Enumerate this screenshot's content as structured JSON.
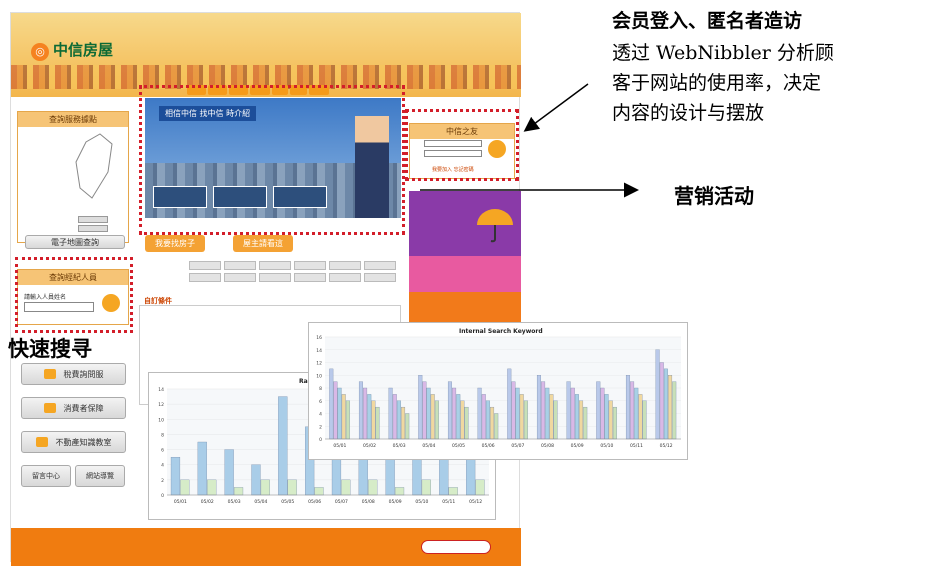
{
  "annotations": {
    "member_title": "会员登入、匿名者造访",
    "member_desc_lines": [
      "透过 WebNibbler 分析顾",
      "客于网站的使用率，决定",
      "内容的设计与摆放"
    ],
    "marketing": "营销活动",
    "quick_search": "快速搜寻"
  },
  "site": {
    "logo_text": "中信房屋",
    "banner_title": "相信中信 找中信 時介紹",
    "tabs": [
      "我要找房子",
      "屋主請看這"
    ],
    "left_panel_title": "查詢服務據點",
    "agent_panel_title": "查詢經紀人員",
    "agent_input_label": "請輸入人員姓名",
    "map_button": "電子地圖查詢",
    "member_panel_title": "中信之友",
    "member_link": "我要加入 忘記密碼",
    "side_buttons": [
      "稅費詢問服",
      "消費者保障",
      "不動產知識教室"
    ],
    "small_buttons": [
      "留言中心",
      "網站導覽"
    ],
    "form_title": "自訂條件",
    "chart_title_front": "Internal Search Keyword"
  },
  "colors": {
    "accent_orange": "#f07c10",
    "dotted_red": "#d31e2a",
    "brand_green": "#0c6a35"
  },
  "chart_data": [
    {
      "type": "bar",
      "title": "Internal Search Keyword",
      "categories": [
        "05/01",
        "05/02",
        "05/03",
        "05/04",
        "05/05",
        "05/06",
        "05/07",
        "05/08",
        "05/09",
        "05/10",
        "05/11",
        "05/12"
      ],
      "ylim": [
        0,
        16
      ],
      "series": [
        {
          "values": [
            11,
            9,
            8,
            10,
            9,
            8,
            11,
            10,
            9,
            9,
            10,
            14
          ]
        },
        {
          "values": [
            9,
            8,
            7,
            9,
            8,
            7,
            9,
            9,
            8,
            8,
            9,
            12
          ]
        },
        {
          "values": [
            8,
            7,
            6,
            8,
            7,
            6,
            8,
            8,
            7,
            7,
            8,
            11
          ]
        },
        {
          "values": [
            7,
            6,
            5,
            7,
            6,
            5,
            7,
            7,
            6,
            6,
            7,
            10
          ]
        },
        {
          "values": [
            6,
            5,
            4,
            6,
            5,
            4,
            6,
            6,
            5,
            5,
            6,
            9
          ]
        }
      ],
      "legend": "bottom"
    },
    {
      "type": "bar",
      "title": "Ran",
      "categories": [
        "05/01",
        "05/02",
        "05/03",
        "05/04",
        "05/05",
        "05/06",
        "05/07",
        "05/08",
        "05/09",
        "05/10",
        "05/11",
        "05/12"
      ],
      "ylim": [
        0,
        14
      ],
      "series": [
        {
          "values": [
            5,
            7,
            6,
            4,
            13,
            9,
            8,
            7,
            6,
            7,
            6,
            5
          ]
        },
        {
          "values": [
            2,
            2,
            1,
            2,
            2,
            1,
            2,
            2,
            1,
            2,
            1,
            2
          ]
        }
      ],
      "legend": "bottom"
    }
  ]
}
